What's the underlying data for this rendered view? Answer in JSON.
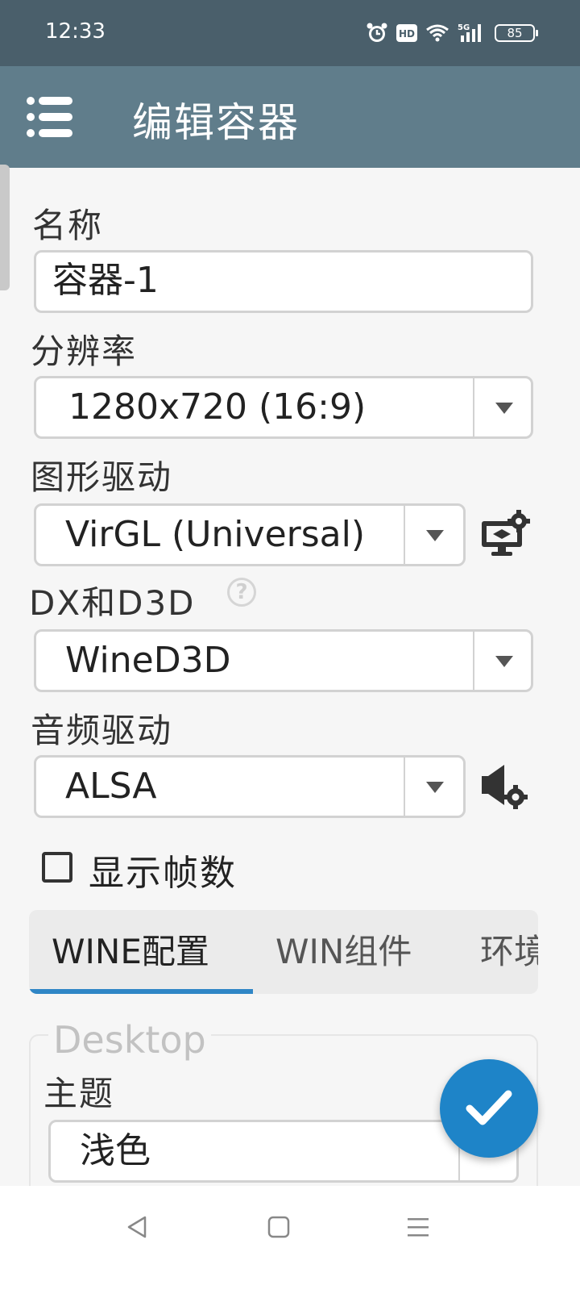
{
  "status_bar": {
    "time": "12:33",
    "icons": [
      "alarm-icon",
      "hd-icon",
      "wifi-icon",
      "5g-signal-icon"
    ],
    "network_label": "5G",
    "hd_label": "HD",
    "battery": "85"
  },
  "app_bar": {
    "title": "编辑容器",
    "menu_icon": "menu-icon",
    "color": "#607d8b"
  },
  "form": {
    "name": {
      "label": "名称",
      "value": "容器-1"
    },
    "resolution": {
      "label": "分辨率",
      "value": "1280x720 (16:9)"
    },
    "graphics_driver": {
      "label": "图形驱动",
      "value": "VirGL (Universal)",
      "settings_icon": "display-settings-icon"
    },
    "dx_d3d": {
      "label": "DX和D3D",
      "value": "WineD3D",
      "help_icon": "?"
    },
    "audio_driver": {
      "label": "音频驱动",
      "value": "ALSA",
      "settings_icon": "audio-settings-icon"
    },
    "show_fps": {
      "label": "显示帧数",
      "checked": false
    }
  },
  "tabs": {
    "items": [
      {
        "label": "WINE配置",
        "active": true
      },
      {
        "label": "WIN组件",
        "active": false
      },
      {
        "label": "环境",
        "active": false
      }
    ],
    "indicator_color": "#2f86c6"
  },
  "desktop_section": {
    "legend": "Desktop",
    "theme_label": "主题",
    "theme_value": "浅色"
  },
  "fab": {
    "icon": "check-icon",
    "color": "#1e84c8"
  },
  "nav_bar": {
    "icons": [
      "back-icon",
      "home-icon",
      "recents-icon"
    ]
  }
}
